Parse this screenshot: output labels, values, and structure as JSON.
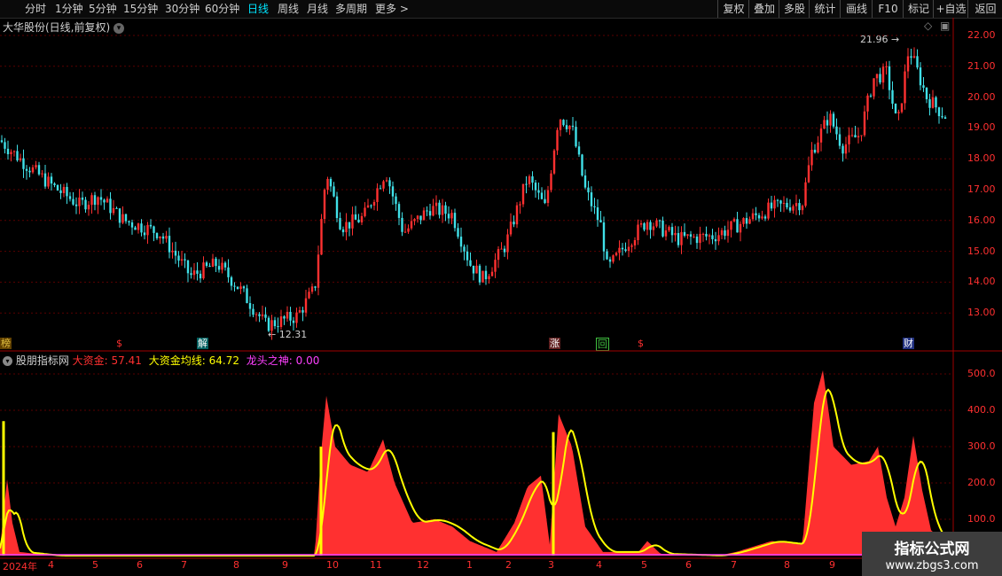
{
  "toolbar": {
    "periods": [
      "分时",
      "1分钟",
      "5分钟",
      "15分钟",
      "30分钟",
      "60分钟",
      "日线",
      "周线",
      "月线",
      "多周期",
      "更多 >"
    ],
    "active_period": "日线",
    "right_buttons": [
      "复权",
      "叠加",
      "多股",
      "统计",
      "画线",
      "F10",
      "标记",
      "+自选",
      "返回"
    ]
  },
  "main_panel": {
    "title": "大华股份(日线,前复权)",
    "high_marker": "21.96",
    "low_marker": "12.31",
    "price_axis": [
      "22.00",
      "21.00",
      "20.00",
      "19.00",
      "18.00",
      "17.00",
      "16.00",
      "15.00",
      "14.00",
      "13.00"
    ],
    "event_badges": [
      {
        "text": "榜",
        "color": "#e0c040"
      },
      {
        "text": "$",
        "color": "#ff3030"
      },
      {
        "text": "解",
        "color": "#00c0c0"
      },
      {
        "text": "涨",
        "color": "#ff5050"
      },
      {
        "text": "回",
        "color": "#40c040"
      },
      {
        "text": "$",
        "color": "#ff3030"
      },
      {
        "text": "财",
        "color": "#4080ff"
      }
    ]
  },
  "indicator_panel": {
    "name": "股朋指标网",
    "line1_label": "大资金:",
    "line1_value": "57.41",
    "line2_label": "大资金均线:",
    "line2_value": "64.72",
    "line3_label": "龙头之神:",
    "line3_value": "0.00",
    "axis": [
      "500.0",
      "400.0",
      "300.0",
      "200.0",
      "100.0"
    ]
  },
  "date_axis": [
    "2024年",
    "4",
    "5",
    "6",
    "7",
    "8",
    "9",
    "10",
    "11",
    "12",
    "1",
    "2",
    "3",
    "4",
    "5",
    "6",
    "7",
    "8",
    "9"
  ],
  "watermark": {
    "line1": "指标公式网",
    "line2": "www.zbgs3.com"
  },
  "colors": {
    "up": "#ff3030",
    "down": "#40e0e8",
    "yellow": "#ffff00",
    "magenta": "#ff40ff",
    "axis": "#ff3030"
  },
  "chart_data": {
    "type": "candlestick",
    "price_range": [
      12.31,
      21.96
    ],
    "indicator_range": [
      0,
      500
    ]
  }
}
